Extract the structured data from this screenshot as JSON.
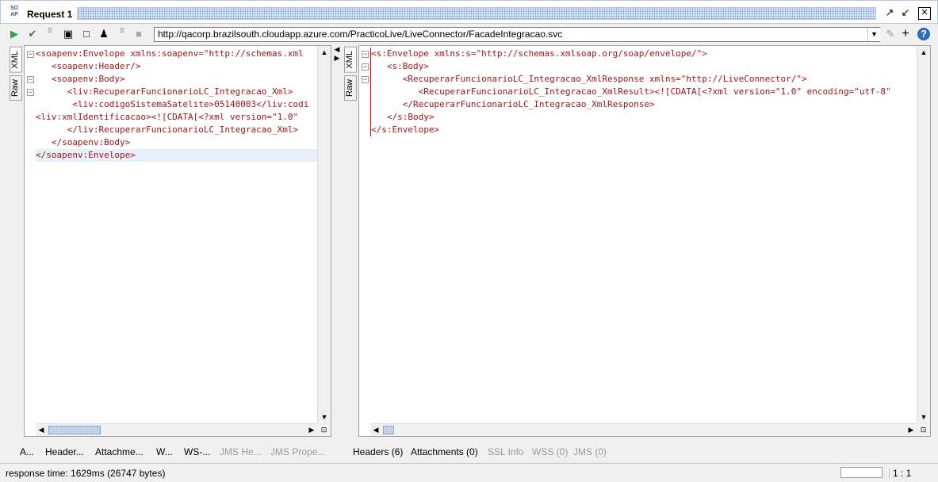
{
  "window": {
    "icon_text": "SO\nAP",
    "title": "Request 1"
  },
  "toolbar": {
    "endpoint_url": "http://qacorp.brazilsouth.cloudapp.azure.com/PracticoLive/LiveConnector/FacadeIntegracao.svc"
  },
  "request_pane": {
    "tabs": [
      "XML",
      "Raw"
    ],
    "lines": [
      "<soapenv:Envelope xmlns:soapenv=\"http://schemas.xml",
      "   <soapenv:Header/>",
      "   <soapenv:Body>",
      "      <liv:RecuperarFuncionarioLC_Integracao_Xml>",
      "       <liv:codigoSistemaSatelite>05140003</liv:codi",
      "<liv:xmlIdentificacao><![CDATA[<?xml version=\"1.0\"",
      "      </liv:RecuperarFuncionarioLC_Integracao_Xml>",
      "   </soapenv:Body>",
      "</soapenv:Envelope>"
    ],
    "bottom_tabs": [
      "A...",
      "Header...",
      "Attachme...",
      "W...",
      "WS-...",
      "JMS He...",
      "JMS Prope..."
    ]
  },
  "response_pane": {
    "tabs": [
      "XML",
      "Raw"
    ],
    "lines": [
      "<s:Envelope xmlns:s=\"http://schemas.xmlsoap.org/soap/envelope/\">",
      "   <s:Body>",
      "      <RecuperarFuncionarioLC_Integracao_XmlResponse xmlns=\"http://LiveConnector/\">",
      "         <RecuperarFuncionarioLC_Integracao_XmlResult><![CDATA[<?xml version=\"1.0\" encoding=\"utf-8\"",
      "      </RecuperarFuncionarioLC_Integracao_XmlResponse>",
      "   </s:Body>",
      "</s:Envelope>"
    ],
    "bottom_tabs": [
      "Headers (6)",
      "Attachments (0)",
      "SSL Info",
      "WSS (0)",
      "JMS (0)"
    ]
  },
  "status": {
    "response_time": "response time: 1629ms (26747 bytes)",
    "cursor_position": "1 : 1"
  },
  "icons": {
    "run": "play-icon",
    "add_assertion": "assertion-icon",
    "stop": "stop-icon"
  },
  "colors": {
    "tag": "#a31515",
    "attribute": "#8a2be2",
    "value": "#0000cc",
    "run_green": "#2ea043"
  }
}
